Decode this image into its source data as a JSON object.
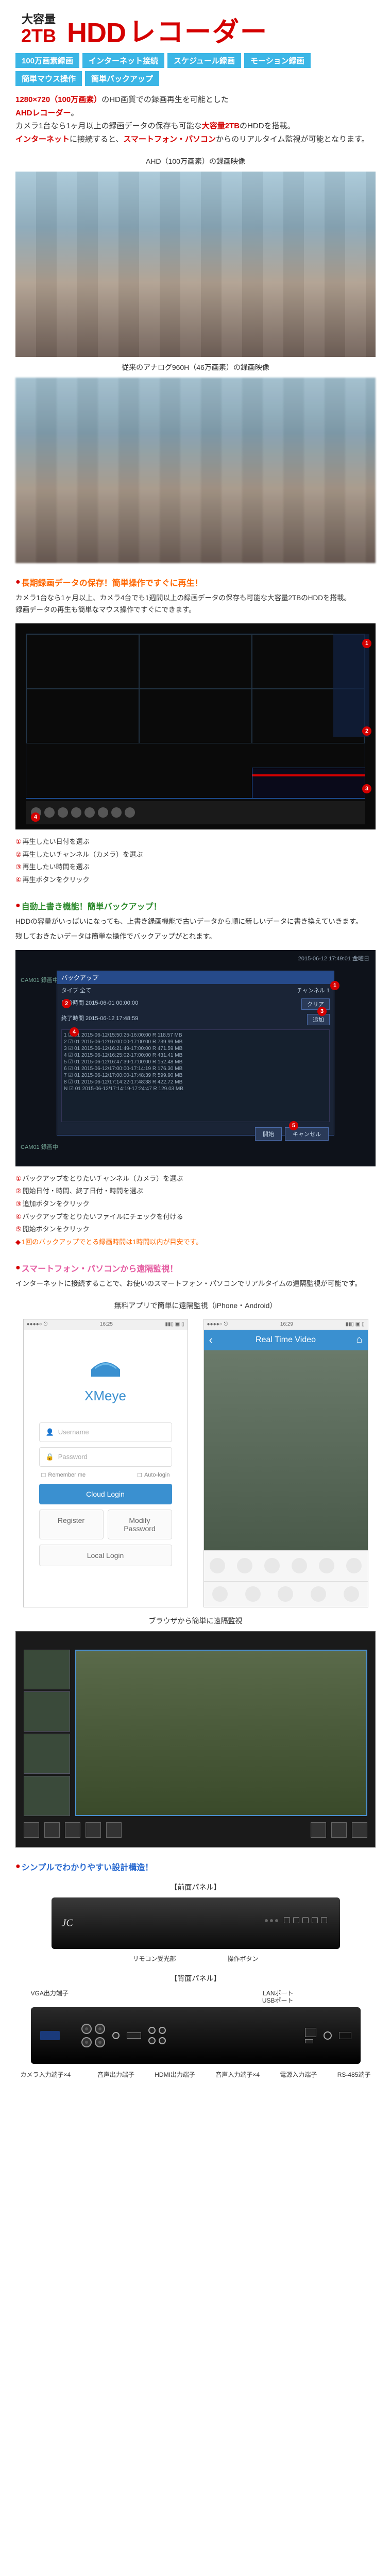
{
  "header": {
    "capacity_label": "大容量",
    "capacity_value": "2TB",
    "title_hdd": "HDD",
    "title_recorder": "レコーダー"
  },
  "tags": {
    "t1": "100万画素録画",
    "t2": "インターネット接続",
    "t3": "スケジュール録画",
    "t4": "モーション録画",
    "t5": "簡単マウス操作",
    "t6": "簡単バックアップ"
  },
  "intro": {
    "line1a": "1280×720（100万画素）",
    "line1b": "のHD画質での録画再生を可能とした",
    "line2a": "AHDレコーダー",
    "line2b": "。",
    "line3a": "カメラ1台なら1ヶ月以上の録画データの保存も可能な",
    "line3b": "大容量2TB",
    "line3c": "のHDDを搭載。",
    "line4a": "インターネット",
    "line4b": "に接続すると、",
    "line4c": "スマートフォン・パソコン",
    "line4d": "からのリアルタイム監視が可能となります。"
  },
  "img_captions": {
    "ahd": "AHD（100万画素）の録画映像",
    "analog": "従来のアナログ960H（46万画素）の録画映像",
    "app": "無料アプリで簡単に遠隔監視（iPhone・Android）",
    "browser": "ブラウザから簡単に遠隔監視",
    "front": "【前面パネル】",
    "back": "【背面パネル】"
  },
  "sec_playback": {
    "title": "長期録画データの保存！簡単操作ですぐに再生！",
    "body": "カメラ1台なら1ヶ月以上、カメラ4台でも1週間以上の録画データの保存も可能な大容量2TBのHDDを搭載。\n録画データの再生も簡単なマウス操作ですぐにできます。",
    "steps": {
      "s1": "再生したい日付を選ぶ",
      "s2": "再生したいチャンネル（カメラ）を選ぶ",
      "s3": "再生したい時間を選ぶ",
      "s4": "再生ボタンをクリック"
    }
  },
  "sec_backup": {
    "title": "自動上書き機能！簡単バックアップ！",
    "body1": "HDDの容量がいっぱいになっても、上書き録画機能で古いデータから順に新しいデータに書き換えていきます。",
    "body2": "残しておきたいデータは簡単な操作でバックアップがとれます。",
    "timestamp": "2015-06-12 17:49:01 金曜日",
    "over_title": "バックアップ",
    "over_type": "タイプ 全て",
    "over_ch": "チャンネル 1",
    "over_start": "開始時間 2015-06-01 00:00:00",
    "over_end": "終了時間 2015-06-12 17:48:59",
    "rows": {
      "r1": "1  ☑  01 2015-06-12/15:50:25-16:00:00  R  118.57 MB",
      "r2": "2  ☑  01 2015-06-12/16:00:00-17:00:00  R  739.99 MB",
      "r3": "3  ☑  01 2015-06-12/16:21:49-17:00:00  R  471.59 MB",
      "r4": "4  ☑  01 2015-06-12/16:25:02-17:00:00  R  431.41 MB",
      "r5": "5  ☑  01 2015-06-12/16:47:39-17:00:00  R  152.48 MB",
      "r6": "6  ☑  01 2015-06-12/17:00:00-17:14:19  R  176.30 MB",
      "r7": "7  ☑  01 2015-06-12/17:00:00-17:48:39  R  599.90 MB",
      "r8": "8  ☑  01 2015-06-12/17:14:22-17:48:38  R  422.72 MB",
      "r9": "N  ☑  01 2015-06-12/17:14:19-17:24:47  R  129.03 MB"
    },
    "btn_add": "追加",
    "btn_clear": "クリア",
    "btn_start": "開始",
    "btn_cancel": "キャンセル",
    "cam_label": "CAM01 録画中",
    "steps": {
      "s1": "バックアップをとりたいチャンネル（カメラ）を選ぶ",
      "s2": "開始日付・時間、終了日付・時間を選ぶ",
      "s3": "追加ボタンをクリック",
      "s4": "バックアップをとりたいファイルにチェックを付ける",
      "s5": "開始ボタンをクリック"
    },
    "note": "1回のバックアップでとる録画時間は1時間以内が目安です。"
  },
  "sec_remote": {
    "title": "スマートフォン・パソコンから遠隔監視！",
    "body": "インターネットに接続することで、お使いのスマートフォン・パソコンでリアルタイムの遠隔監視が可能です。"
  },
  "app": {
    "time": "16:25",
    "logo_text": "XMeye",
    "ph_user": "Username",
    "ph_pass": "Password",
    "remember": "Remember me",
    "auto": "Auto-login",
    "btn_cloud": "Cloud Login",
    "btn_reg": "Register",
    "btn_pw": "Modify Password",
    "btn_local": "Local Login",
    "video_title": "Real Time Video",
    "time2": "16:29"
  },
  "sec_design": {
    "title": "シンプルでわかりやすい設計構造！"
  },
  "hw": {
    "front_remote": "リモコン受光部",
    "front_btns": "操作ボタン",
    "back_vga": "VGA出力端子",
    "back_cam": "カメラ入力端子×4",
    "back_aout": "音声出力端子",
    "back_hdmi": "HDMI出力端子",
    "back_ain": "音声入力端子×4",
    "back_lan": "LANポート",
    "back_usb": "USBポート",
    "back_pwr": "電源入力端子",
    "back_rs485": "RS-485端子"
  }
}
